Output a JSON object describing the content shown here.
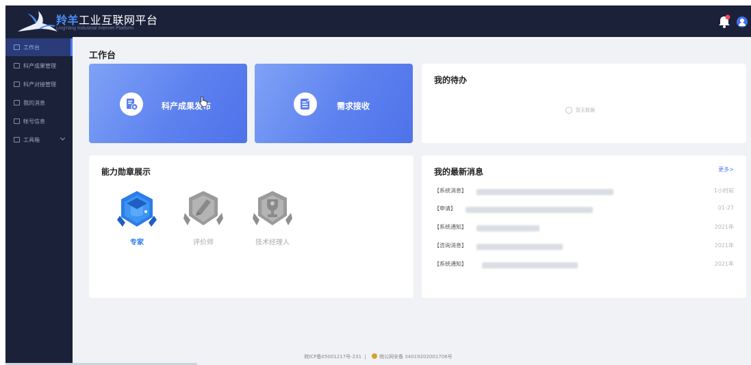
{
  "header": {
    "brand_prefix": "羚羊",
    "brand_suffix": "工业互联网平台",
    "brand_subtitle": "LingYang Industrial Internet Platform"
  },
  "sidebar": {
    "items": [
      {
        "label": "工作台",
        "active": true
      },
      {
        "label": "科产成果管理",
        "active": false
      },
      {
        "label": "科产对接管理",
        "active": false
      },
      {
        "label": "我的消息",
        "active": false
      },
      {
        "label": "帐号信息",
        "active": false
      },
      {
        "label": "工具箱",
        "active": false,
        "expandable": true
      }
    ]
  },
  "main": {
    "page_title": "工作台",
    "quick_actions": [
      {
        "label": "科产成果发布",
        "icon": "folder-star-icon"
      },
      {
        "label": "需求接收",
        "icon": "edit-note-icon"
      }
    ],
    "todo": {
      "title": "我的待办",
      "empty_text": "暂无数据"
    },
    "badges": {
      "title": "能力勋章展示",
      "items": [
        {
          "label": "专家",
          "earned": true
        },
        {
          "label": "评价师",
          "earned": false
        },
        {
          "label": "技术经理人",
          "earned": false
        }
      ]
    },
    "messages": {
      "title": "我的最新消息",
      "more_label": "更多>",
      "items": [
        {
          "category": "【系统消息】",
          "time": "1小时前"
        },
        {
          "category": "【申请】",
          "time": "01-27"
        },
        {
          "category": "【系统通知】",
          "time": "2021年"
        },
        {
          "category": "【咨询消息】",
          "time": "2021年"
        },
        {
          "category": "【系统通知】",
          "time": "2021年"
        }
      ]
    }
  },
  "footer": {
    "icp": "皖ICP备05001217号-231",
    "separator": "|",
    "police": "皖公网安备 34019202001706号"
  },
  "colors": {
    "header_bg": "#1b2139",
    "accent": "#4c7cf3",
    "card_gradient_start": "#7fa2f6",
    "card_gradient_end": "#4f72ea",
    "badge_active": "#2b7de9",
    "badge_inactive": "#9a9a9a"
  }
}
